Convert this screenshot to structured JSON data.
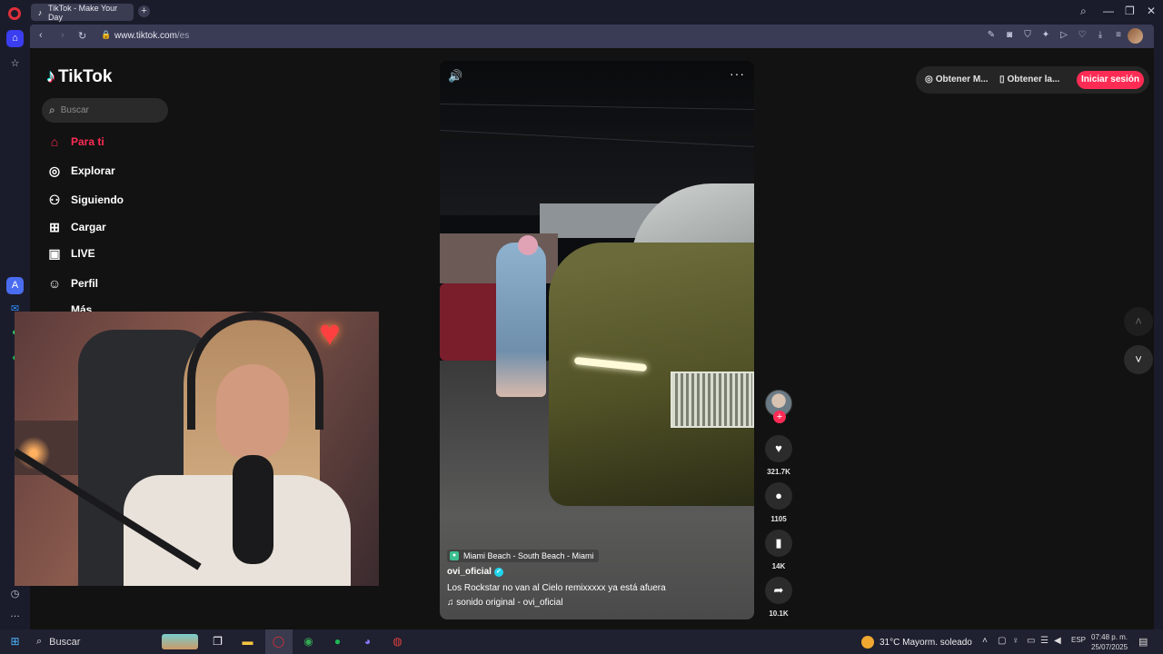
{
  "browser": {
    "tab_title": "TikTok - Make Your Day",
    "new_tab": "+",
    "url_host": "www.tiktok.com",
    "url_path": "/es",
    "controls": {
      "search": "⌕",
      "minimize": "—",
      "restore": "❐",
      "close": "✕"
    }
  },
  "sidebar": {
    "logo": "TikTok",
    "search_placeholder": "Buscar",
    "nav": [
      {
        "label": "Para ti",
        "icon": "home-icon",
        "glyph": "⌂"
      },
      {
        "label": "Explorar",
        "icon": "compass-icon",
        "glyph": "◎"
      },
      {
        "label": "Siguiendo",
        "icon": "user-follow-icon",
        "glyph": "⚇"
      },
      {
        "label": "Cargar",
        "icon": "upload-icon",
        "glyph": "⊞"
      },
      {
        "label": "LIVE",
        "icon": "live-icon",
        "glyph": "▣"
      },
      {
        "label": "Perfil",
        "icon": "profile-icon",
        "glyph": "☺"
      },
      {
        "label": "Más",
        "icon": "more-icon",
        "glyph": "…"
      }
    ]
  },
  "video": {
    "location": "Miami Beach - South Beach - Miami",
    "author": "ovi_oficial",
    "description": "Los Rockstar no van al Cielo remixxxxx ya está afuera",
    "sound": "♫  sonido original - ovi_oficial"
  },
  "actions": {
    "likes": "321.7K",
    "comments": "1105",
    "saves": "14K",
    "shares": "10.1K"
  },
  "topbar": {
    "get_coins": "Obtener M...",
    "get_app": "Obtener la...",
    "login": "Iniciar sesión"
  },
  "taskbar": {
    "search": "Buscar",
    "weather": "31°C  Mayorm. soleado",
    "lang": "ESP",
    "time": "07:48 p. m.",
    "date": "25/07/2025"
  },
  "colors": {
    "accent": "#fe2c55",
    "page_bg": "#121212",
    "browser_bg": "#1b1c2b"
  }
}
